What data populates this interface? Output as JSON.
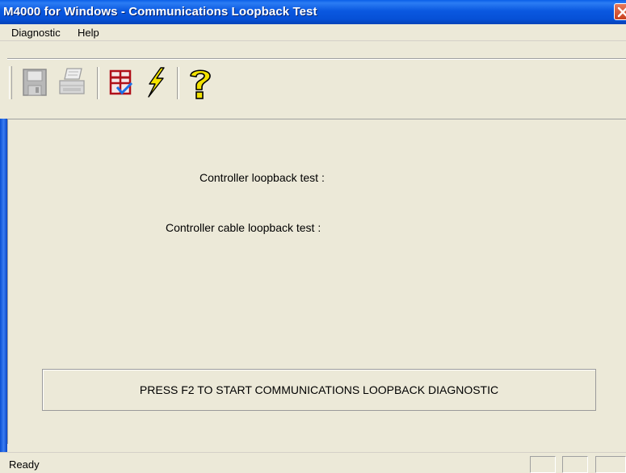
{
  "window": {
    "title": "M4000 for Windows - Communications Loopback Test"
  },
  "menubar": {
    "items": [
      {
        "label": "Diagnostic"
      },
      {
        "label": "Help"
      }
    ]
  },
  "toolbar": {
    "buttons": [
      {
        "icon": "save-icon",
        "enabled": false
      },
      {
        "icon": "print-icon",
        "enabled": false
      },
      {
        "icon": "checklist-icon",
        "enabled": true
      },
      {
        "icon": "lightning-icon",
        "enabled": true
      },
      {
        "icon": "help-icon",
        "enabled": true
      }
    ]
  },
  "main": {
    "controller_loopback_label": "Controller loopback test :",
    "cable_loopback_label": "Controller cable loopback test :",
    "instruction": "PRESS F2 TO START COMMUNICATIONS LOOPBACK DIAGNOSTIC"
  },
  "statusbar": {
    "text": "Ready"
  },
  "colors": {
    "titlebar": "#0a58e0",
    "face": "#ece9d8",
    "close": "#d9542e"
  }
}
